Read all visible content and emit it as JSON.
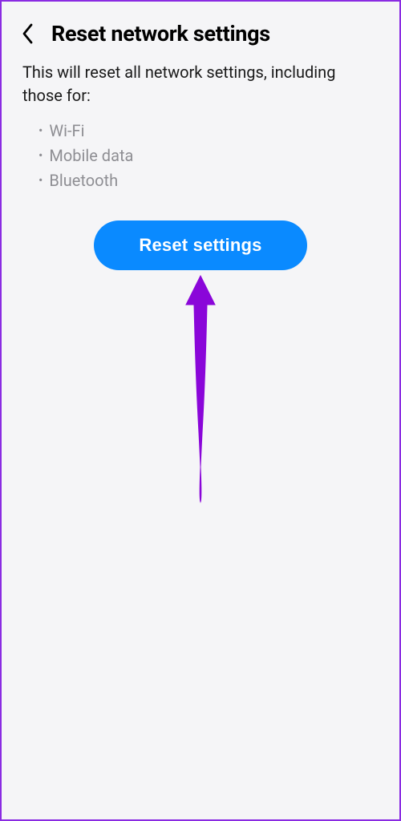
{
  "header": {
    "title": "Reset network settings"
  },
  "description": "This will reset all network settings, including those for:",
  "bullets": {
    "0": "Wi-Fi",
    "1": "Mobile data",
    "2": "Bluetooth"
  },
  "button": {
    "label": "Reset settings"
  },
  "colors": {
    "primary": "#0a8aff",
    "annotation": "#8a06d9"
  }
}
